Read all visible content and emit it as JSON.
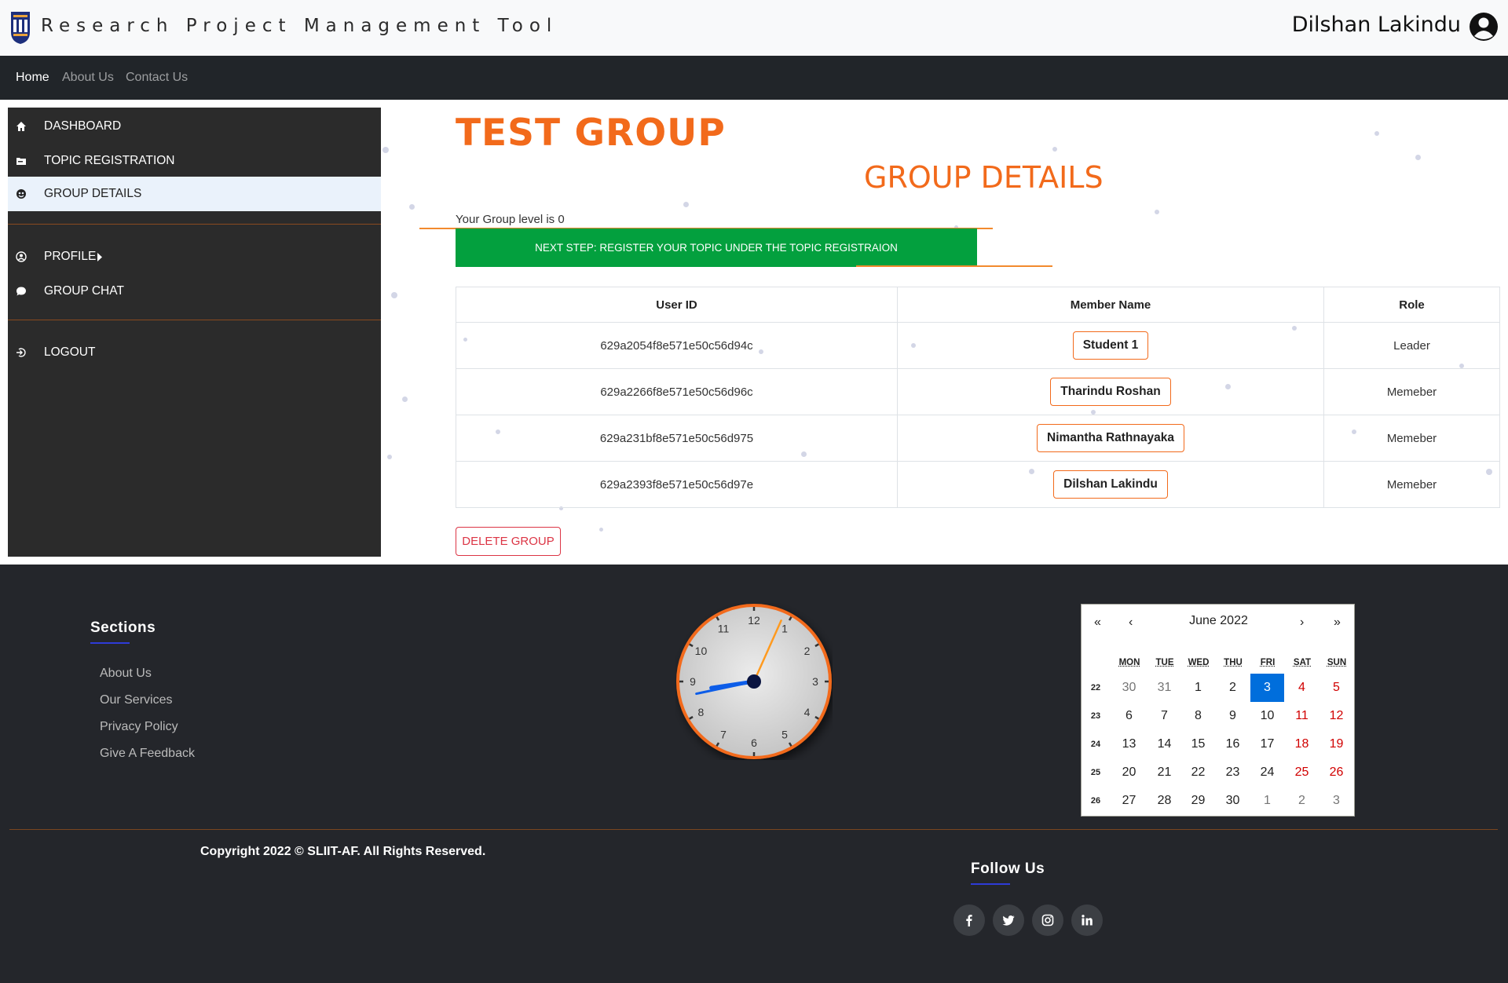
{
  "header": {
    "app_title": "Research Project Management Tool",
    "user_name": "Dilshan Lakindu"
  },
  "navbar": {
    "links": [
      {
        "label": "Home",
        "active": true
      },
      {
        "label": "About Us",
        "active": false
      },
      {
        "label": "Contact Us",
        "active": false
      }
    ]
  },
  "sidebar": {
    "items": [
      {
        "label": "DASHBOARD",
        "icon": "home-icon"
      },
      {
        "label": "TOPIC REGISTRATION",
        "icon": "folder-icon"
      },
      {
        "label": "GROUP DETAILS",
        "icon": "group-icon",
        "active": true
      },
      {
        "label": "PROFILE",
        "icon": "user-circle-icon"
      },
      {
        "label": "GROUP CHAT",
        "icon": "chat-icon"
      },
      {
        "label": "LOGOUT",
        "icon": "logout-icon"
      }
    ]
  },
  "main": {
    "group_name": "TEST GROUP",
    "section_title": "GROUP DETAILS",
    "group_level_text": "Your Group level is 0",
    "next_step": "NEXT STEP: REGISTER YOUR TOPIC UNDER THE TOPIC REGISTRAION",
    "table": {
      "headers": [
        "User ID",
        "Member Name",
        "Role"
      ],
      "rows": [
        {
          "user_id": "629a2054f8e571e50c56d94c",
          "name": "Student 1",
          "role": "Leader"
        },
        {
          "user_id": "629a2266f8e571e50c56d96c",
          "name": "Tharindu Roshan",
          "role": "Memeber"
        },
        {
          "user_id": "629a231bf8e571e50c56d975",
          "name": "Nimantha Rathnayaka",
          "role": "Memeber"
        },
        {
          "user_id": "629a2393f8e571e50c56d97e",
          "name": "Dilshan Lakindu",
          "role": "Memeber"
        }
      ]
    },
    "delete_button": "DELETE GROUP"
  },
  "footer": {
    "sections_title": "Sections",
    "links": [
      "About Us",
      "Our Services",
      "Privacy Policy",
      "Give A Feedback"
    ],
    "copyright": "Copyright 2022 © SLIIT-AF. All Rights Reserved.",
    "follow_title": "Follow Us",
    "social": [
      "facebook-icon",
      "twitter-icon",
      "instagram-icon",
      "linkedin-icon"
    ]
  },
  "clock": {
    "numbers": [
      "12",
      "1",
      "2",
      "3",
      "4",
      "5",
      "6",
      "7",
      "8",
      "9",
      "10",
      "11"
    ],
    "hour": 8,
    "minute": 43,
    "second": 4
  },
  "calendar": {
    "month_label": "June 2022",
    "nav": [
      "«",
      "‹",
      "›",
      "»"
    ],
    "weekdays": [
      "MON",
      "TUE",
      "WED",
      "THU",
      "FRI",
      "SAT",
      "SUN"
    ],
    "weeks": [
      {
        "num": "22",
        "days": [
          "30",
          "31",
          "1",
          "2",
          "3",
          "4",
          "5"
        ]
      },
      {
        "num": "23",
        "days": [
          "6",
          "7",
          "8",
          "9",
          "10",
          "11",
          "12"
        ]
      },
      {
        "num": "24",
        "days": [
          "13",
          "14",
          "15",
          "16",
          "17",
          "18",
          "19"
        ]
      },
      {
        "num": "25",
        "days": [
          "20",
          "21",
          "22",
          "23",
          "24",
          "25",
          "26"
        ]
      },
      {
        "num": "26",
        "days": [
          "27",
          "28",
          "29",
          "30",
          "1",
          "2",
          "3"
        ]
      }
    ],
    "today": "3",
    "colors": {
      "today": "#006edc",
      "weekend": "#d10000",
      "neighbor": "#757575"
    }
  },
  "colors": {
    "accent_orange": "#f26a1b",
    "next_step_green": "#03a03e",
    "navbar": "#212529",
    "sidebar": "#2b2b2b",
    "footer": "#24262b"
  }
}
